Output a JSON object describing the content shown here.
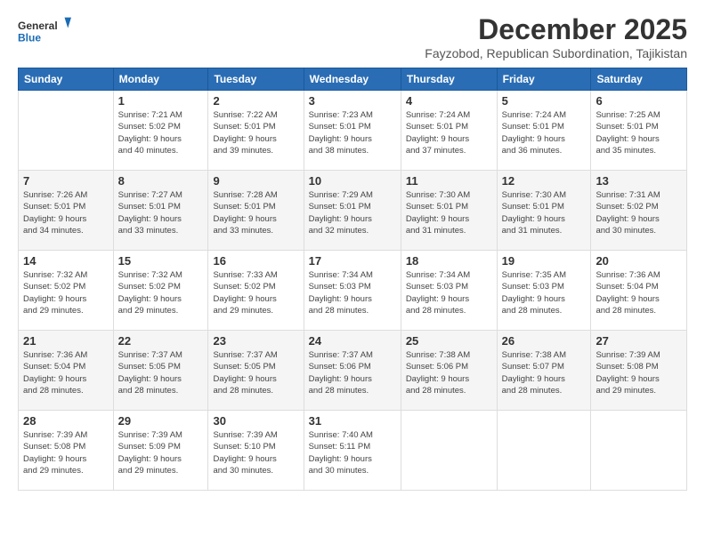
{
  "logo": {
    "line1": "General",
    "line2": "Blue"
  },
  "header": {
    "title": "December 2025",
    "subtitle": "Fayzobod, Republican Subordination, Tajikistan"
  },
  "weekdays": [
    "Sunday",
    "Monday",
    "Tuesday",
    "Wednesday",
    "Thursday",
    "Friday",
    "Saturday"
  ],
  "weeks": [
    [
      {
        "day": "",
        "info": ""
      },
      {
        "day": "1",
        "info": "Sunrise: 7:21 AM\nSunset: 5:02 PM\nDaylight: 9 hours\nand 40 minutes."
      },
      {
        "day": "2",
        "info": "Sunrise: 7:22 AM\nSunset: 5:01 PM\nDaylight: 9 hours\nand 39 minutes."
      },
      {
        "day": "3",
        "info": "Sunrise: 7:23 AM\nSunset: 5:01 PM\nDaylight: 9 hours\nand 38 minutes."
      },
      {
        "day": "4",
        "info": "Sunrise: 7:24 AM\nSunset: 5:01 PM\nDaylight: 9 hours\nand 37 minutes."
      },
      {
        "day": "5",
        "info": "Sunrise: 7:24 AM\nSunset: 5:01 PM\nDaylight: 9 hours\nand 36 minutes."
      },
      {
        "day": "6",
        "info": "Sunrise: 7:25 AM\nSunset: 5:01 PM\nDaylight: 9 hours\nand 35 minutes."
      }
    ],
    [
      {
        "day": "7",
        "info": "Sunrise: 7:26 AM\nSunset: 5:01 PM\nDaylight: 9 hours\nand 34 minutes."
      },
      {
        "day": "8",
        "info": "Sunrise: 7:27 AM\nSunset: 5:01 PM\nDaylight: 9 hours\nand 33 minutes."
      },
      {
        "day": "9",
        "info": "Sunrise: 7:28 AM\nSunset: 5:01 PM\nDaylight: 9 hours\nand 33 minutes."
      },
      {
        "day": "10",
        "info": "Sunrise: 7:29 AM\nSunset: 5:01 PM\nDaylight: 9 hours\nand 32 minutes."
      },
      {
        "day": "11",
        "info": "Sunrise: 7:30 AM\nSunset: 5:01 PM\nDaylight: 9 hours\nand 31 minutes."
      },
      {
        "day": "12",
        "info": "Sunrise: 7:30 AM\nSunset: 5:01 PM\nDaylight: 9 hours\nand 31 minutes."
      },
      {
        "day": "13",
        "info": "Sunrise: 7:31 AM\nSunset: 5:02 PM\nDaylight: 9 hours\nand 30 minutes."
      }
    ],
    [
      {
        "day": "14",
        "info": "Sunrise: 7:32 AM\nSunset: 5:02 PM\nDaylight: 9 hours\nand 29 minutes."
      },
      {
        "day": "15",
        "info": "Sunrise: 7:32 AM\nSunset: 5:02 PM\nDaylight: 9 hours\nand 29 minutes."
      },
      {
        "day": "16",
        "info": "Sunrise: 7:33 AM\nSunset: 5:02 PM\nDaylight: 9 hours\nand 29 minutes."
      },
      {
        "day": "17",
        "info": "Sunrise: 7:34 AM\nSunset: 5:03 PM\nDaylight: 9 hours\nand 28 minutes."
      },
      {
        "day": "18",
        "info": "Sunrise: 7:34 AM\nSunset: 5:03 PM\nDaylight: 9 hours\nand 28 minutes."
      },
      {
        "day": "19",
        "info": "Sunrise: 7:35 AM\nSunset: 5:03 PM\nDaylight: 9 hours\nand 28 minutes."
      },
      {
        "day": "20",
        "info": "Sunrise: 7:36 AM\nSunset: 5:04 PM\nDaylight: 9 hours\nand 28 minutes."
      }
    ],
    [
      {
        "day": "21",
        "info": "Sunrise: 7:36 AM\nSunset: 5:04 PM\nDaylight: 9 hours\nand 28 minutes."
      },
      {
        "day": "22",
        "info": "Sunrise: 7:37 AM\nSunset: 5:05 PM\nDaylight: 9 hours\nand 28 minutes."
      },
      {
        "day": "23",
        "info": "Sunrise: 7:37 AM\nSunset: 5:05 PM\nDaylight: 9 hours\nand 28 minutes."
      },
      {
        "day": "24",
        "info": "Sunrise: 7:37 AM\nSunset: 5:06 PM\nDaylight: 9 hours\nand 28 minutes."
      },
      {
        "day": "25",
        "info": "Sunrise: 7:38 AM\nSunset: 5:06 PM\nDaylight: 9 hours\nand 28 minutes."
      },
      {
        "day": "26",
        "info": "Sunrise: 7:38 AM\nSunset: 5:07 PM\nDaylight: 9 hours\nand 28 minutes."
      },
      {
        "day": "27",
        "info": "Sunrise: 7:39 AM\nSunset: 5:08 PM\nDaylight: 9 hours\nand 29 minutes."
      }
    ],
    [
      {
        "day": "28",
        "info": "Sunrise: 7:39 AM\nSunset: 5:08 PM\nDaylight: 9 hours\nand 29 minutes."
      },
      {
        "day": "29",
        "info": "Sunrise: 7:39 AM\nSunset: 5:09 PM\nDaylight: 9 hours\nand 29 minutes."
      },
      {
        "day": "30",
        "info": "Sunrise: 7:39 AM\nSunset: 5:10 PM\nDaylight: 9 hours\nand 30 minutes."
      },
      {
        "day": "31",
        "info": "Sunrise: 7:40 AM\nSunset: 5:11 PM\nDaylight: 9 hours\nand 30 minutes."
      },
      {
        "day": "",
        "info": ""
      },
      {
        "day": "",
        "info": ""
      },
      {
        "day": "",
        "info": ""
      }
    ]
  ]
}
